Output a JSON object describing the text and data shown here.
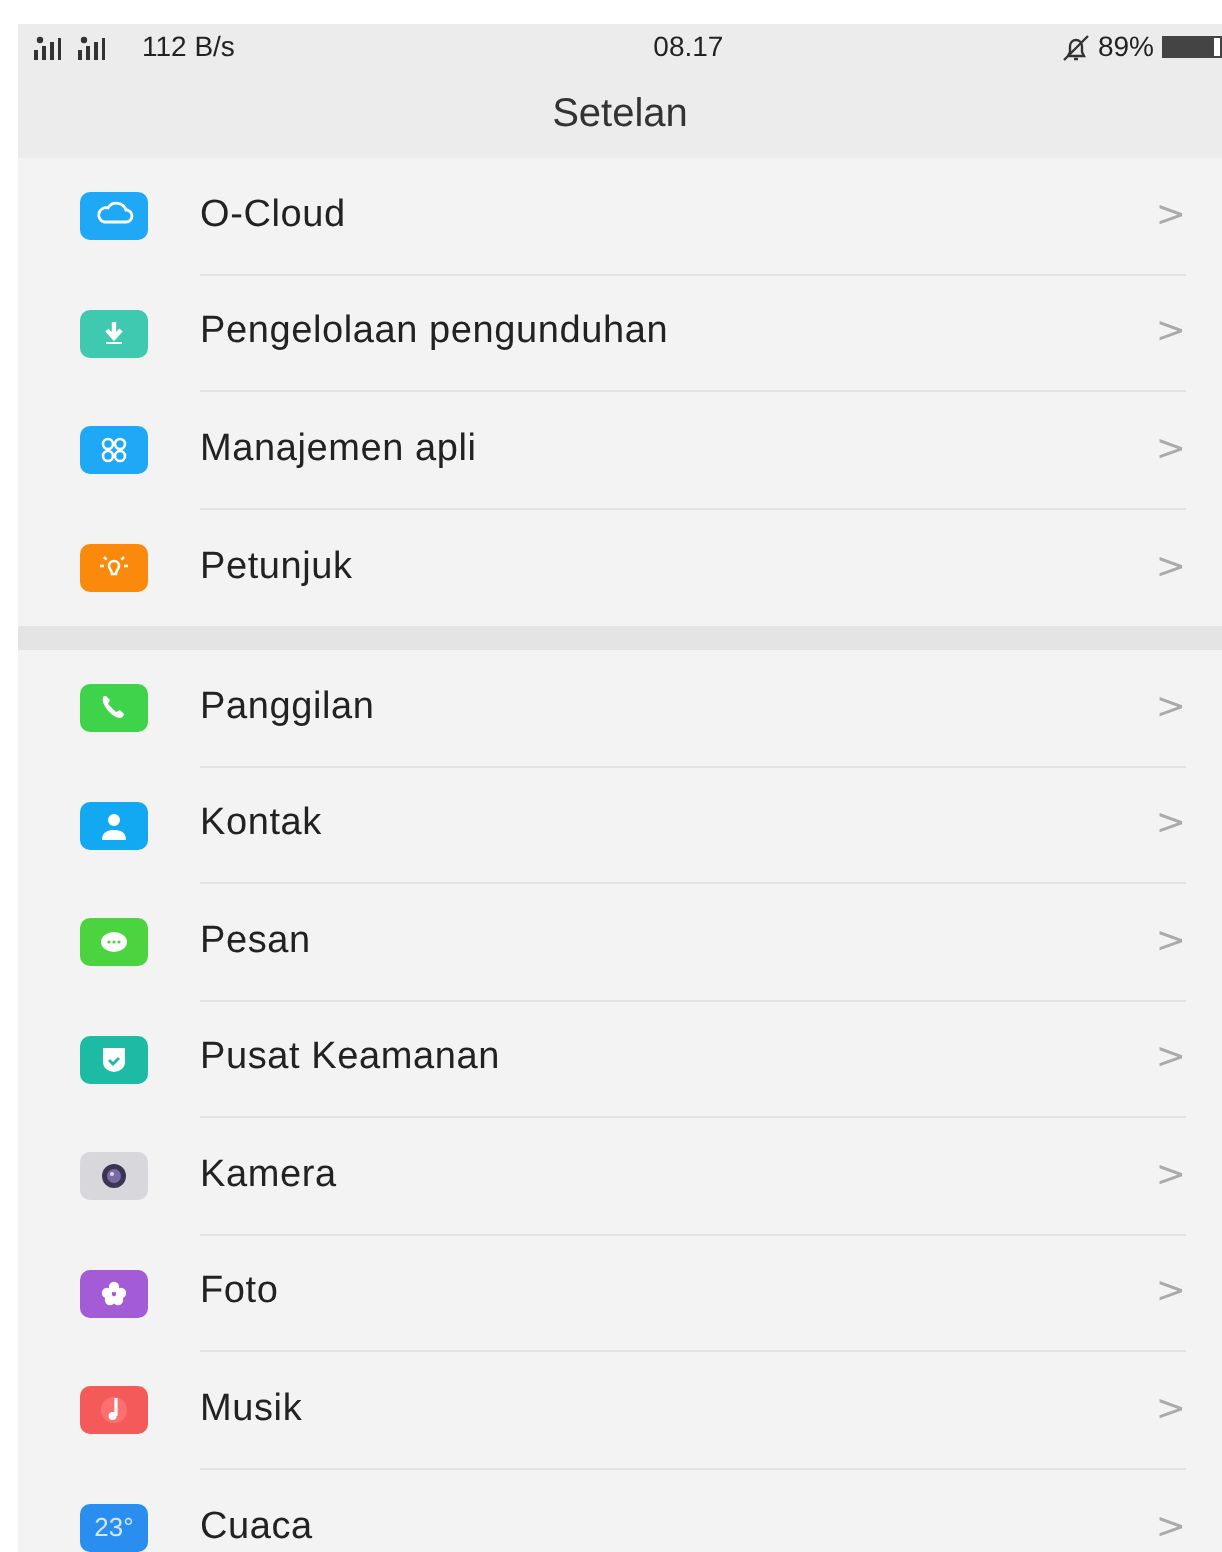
{
  "status_bar": {
    "network": "112 B/s",
    "time": "08.17",
    "battery": "89%"
  },
  "title": "Setelan",
  "groups": [
    {
      "items": [
        {
          "label": "O-Cloud",
          "kind": "cloud",
          "color": "#1fa8f5",
          "chevron": ">"
        },
        {
          "label": "Pengelolaan pengunduhan",
          "kind": "download",
          "color": "#3ec9b0",
          "chevron": ">"
        },
        {
          "label": "Manajemen apli",
          "kind": "apps",
          "color": "#1fa8f5",
          "chevron": ">"
        },
        {
          "label": "Petunjuk",
          "kind": "bulb",
          "color": "#fb8a0c",
          "chevron": ">"
        }
      ]
    },
    {
      "items": [
        {
          "label": "Panggilan",
          "kind": "phone",
          "color": "#3ed34a",
          "chevron": ">"
        },
        {
          "label": "Kontak",
          "kind": "contact",
          "color": "#13a9f2",
          "chevron": ">"
        },
        {
          "label": "Pesan",
          "kind": "message",
          "color": "#4bd43f",
          "chevron": ">"
        },
        {
          "label": "Pusat Keamanan",
          "kind": "shield",
          "color": "#1dbba3",
          "chevron": ">"
        },
        {
          "label": "Kamera",
          "kind": "camera",
          "color": "#d8d8dc",
          "chevron": ">"
        },
        {
          "label": "Foto",
          "kind": "flower",
          "color": "#a45bd6",
          "chevron": ">"
        },
        {
          "label": "Musik",
          "kind": "music",
          "color": "#f55a5a",
          "chevron": ">"
        },
        {
          "label": "Cuaca",
          "kind": "weather",
          "color": "#2a8df0",
          "icon_text": "23°",
          "chevron": ">"
        }
      ]
    }
  ]
}
